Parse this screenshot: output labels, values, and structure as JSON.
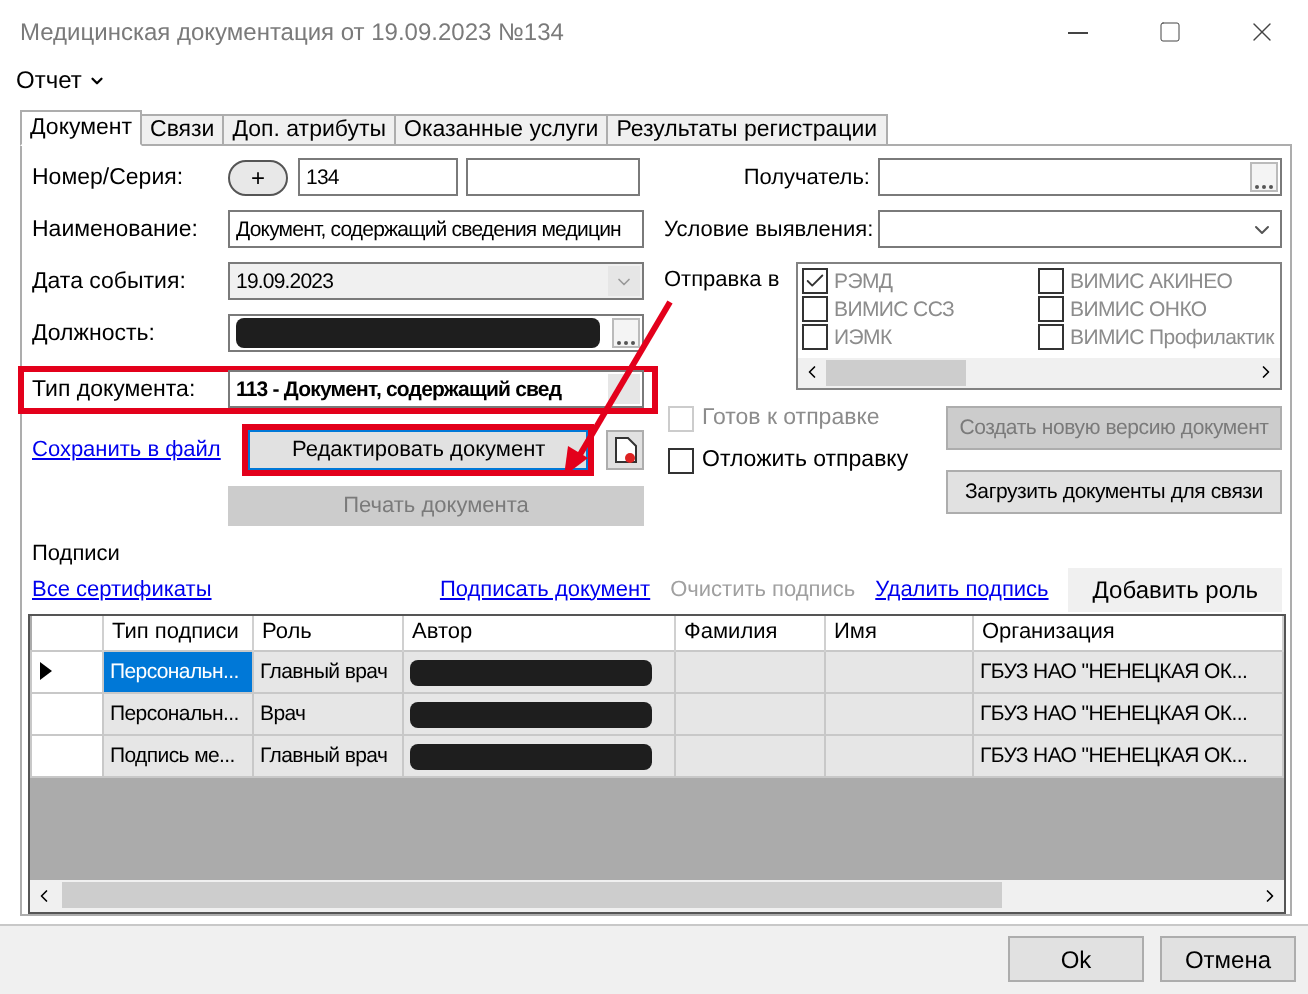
{
  "window": {
    "title": "Медицинская документация от 19.09.2023 №134"
  },
  "menu": [
    {
      "label": "Отчет"
    }
  ],
  "tabs": [
    {
      "label": "Документ",
      "selected": true
    },
    {
      "label": "Связи",
      "selected": false
    },
    {
      "label": "Доп. атрибуты",
      "selected": false
    },
    {
      "label": "Оказанные услуги",
      "selected": false
    },
    {
      "label": "Результаты регистрации",
      "selected": false
    }
  ],
  "form": {
    "number_label": "Номер/Серия:",
    "add_button": "+",
    "number": "134",
    "name_label": "Наименование:",
    "name_value": "Документ, содержащий сведения медицин",
    "date_label": "Дата события:",
    "date_value": "19.09.2023",
    "position_label": "Должность:",
    "doc_type_label": "Тип документа:",
    "doc_type_value": "113 - Документ, содержащий свед"
  },
  "actions": {
    "save_link": "Сохранить в файл",
    "edit_button": "Редактировать документ",
    "print_button": {
      "label": "Печать документа",
      "disabled": true
    }
  },
  "right": {
    "recipient_label": "Получатель:",
    "condition_label": "Условие выявления:",
    "send_label": "Отправка в",
    "send_targets": {
      "disabled": true,
      "items": [
        {
          "label": "РЭМД",
          "checked": true
        },
        {
          "label": "ВИМИС ССЗ",
          "checked": false
        },
        {
          "label": "ИЭМК",
          "checked": false
        },
        {
          "label": "ВИМИС АКИНЕО",
          "checked": false
        },
        {
          "label": "ВИМИС ОНКО",
          "checked": false
        },
        {
          "label": "ВИМИС Профилактик",
          "checked": false
        }
      ]
    },
    "ready": {
      "label": "Готов к отправке",
      "checked": false,
      "disabled": true
    },
    "postpone": {
      "label": "Отложить отправку",
      "checked": false,
      "disabled": false
    },
    "new_version_button": {
      "label": "Создать новую версию документ",
      "disabled": true
    },
    "load_button": {
      "label": "Загрузить документы для связи",
      "disabled": false
    }
  },
  "signatures": {
    "title": "Подписи",
    "all_certs": "Все сертификаты",
    "links": [
      {
        "label": "Подписать документ",
        "disabled": false
      },
      {
        "label": "Очистить подпись",
        "disabled": true
      },
      {
        "label": "Удалить подпись",
        "disabled": false
      }
    ],
    "add_role": "Добавить роль",
    "columns": [
      "Тип подписи",
      "Роль",
      "Автор",
      "Фамилия",
      "Имя",
      "Организация"
    ],
    "rows": [
      {
        "selected": true,
        "signature_type": "Персональн...",
        "role": "Главный врач",
        "organization": "ГБУЗ НАО \"НЕНЕЦКАЯ ОК..."
      },
      {
        "selected": false,
        "signature_type": "Персональн...",
        "role": "Врач",
        "organization": "ГБУЗ НАО \"НЕНЕЦКАЯ ОК..."
      },
      {
        "selected": false,
        "signature_type": "Подпись ме...",
        "role": "Главный врач",
        "organization": "ГБУЗ НАО \"НЕНЕЦКАЯ ОК..."
      }
    ]
  },
  "buttons": [
    {
      "label": "Ok"
    },
    {
      "label": "Отмена"
    }
  ]
}
